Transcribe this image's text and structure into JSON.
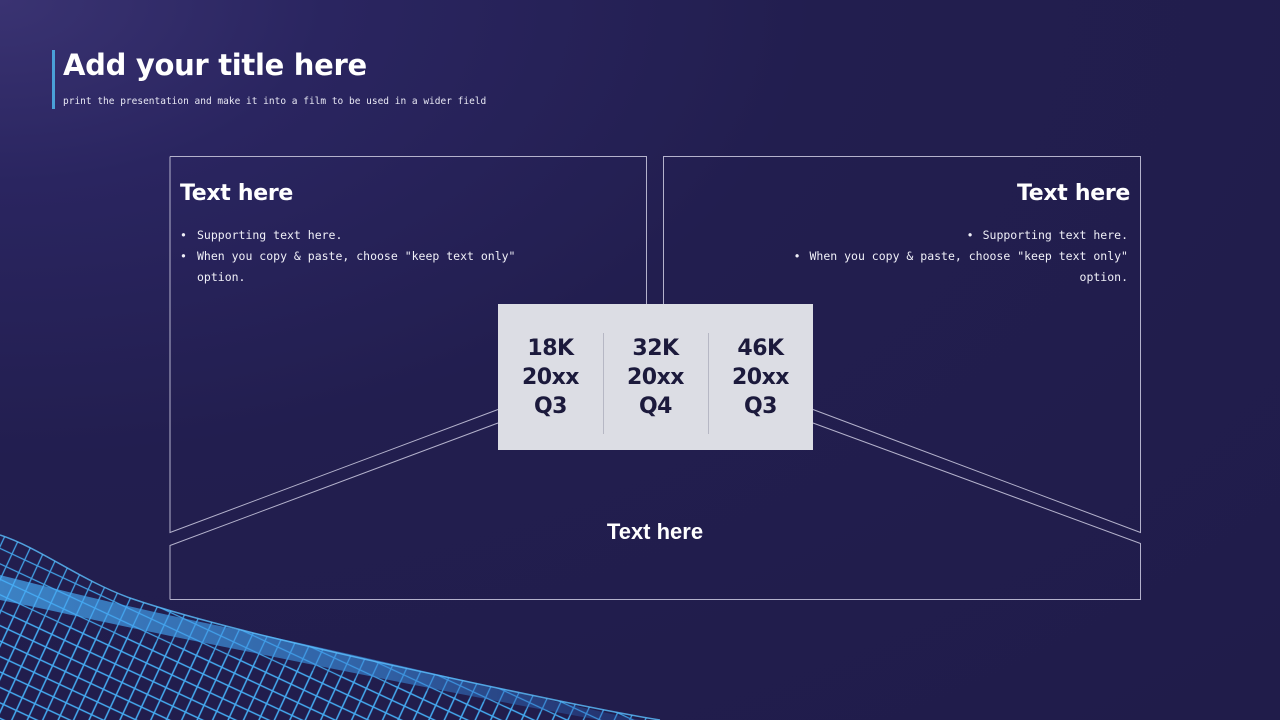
{
  "slide": {
    "title": "Add your title here",
    "subtitle": "print the presentation and make it into a film to be used in a wider field"
  },
  "left_card": {
    "title": "Text here",
    "bullets": [
      "Supporting text here.",
      "When you copy & paste, choose \"keep text only\" option."
    ]
  },
  "right_card": {
    "title": "Text here",
    "bullets": [
      "Supporting text here.",
      "When you copy & paste, choose \"keep text only\"",
      "option."
    ]
  },
  "stats": [
    {
      "value": "18K",
      "year": "20xx",
      "quarter": "Q3"
    },
    {
      "value": "32K",
      "year": "20xx",
      "quarter": "Q4"
    },
    {
      "value": "46K",
      "year": "20xx",
      "quarter": "Q3"
    }
  ],
  "bottom_card": {
    "title": "Text here"
  },
  "colors": {
    "background": "#221e4f",
    "accent": "#4aa0d8",
    "stats_panel": "#dcdde4",
    "wave": "#3fa7f0"
  }
}
